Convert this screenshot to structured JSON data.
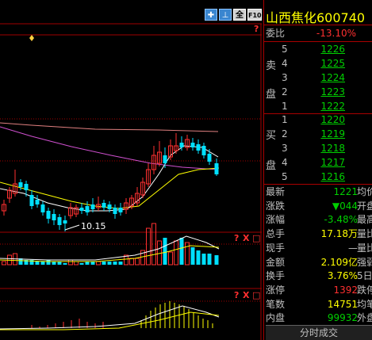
{
  "toolbar": {
    "btn_cross_glyph": "✚",
    "btn_flag_glyph": "⊥",
    "btn_full_label": "全",
    "btn_f10_label": "F10",
    "help_glyph": "?",
    "close_glyph": "X",
    "window_glyph": "□"
  },
  "stock": {
    "title": "山西焦化600740"
  },
  "chart": {
    "low_label": "10.15"
  },
  "quote": {
    "webi_label": "委比",
    "webi_value": "-13.10%",
    "sell_side": "卖盘",
    "buy_side": "买盘",
    "sell_levels": [
      {
        "level": "5",
        "price": "1226"
      },
      {
        "level": "4",
        "price": "1225"
      },
      {
        "level": "3",
        "price": "1224"
      },
      {
        "level": "2",
        "price": "1223"
      },
      {
        "level": "1",
        "price": "1222"
      }
    ],
    "buy_levels": [
      {
        "level": "1",
        "price": "1220"
      },
      {
        "level": "2",
        "price": "1219"
      },
      {
        "level": "3",
        "price": "1218"
      },
      {
        "level": "4",
        "price": "1217"
      },
      {
        "level": "5",
        "price": "1216"
      }
    ],
    "stats": [
      {
        "label": "最新",
        "value": "1221",
        "extra": "均价",
        "color": "#00d000"
      },
      {
        "label": "涨跌",
        "value": "▼044",
        "extra": "开盘",
        "color": "#00d000"
      },
      {
        "label": "涨幅",
        "value": "-3.48%",
        "extra": "最高",
        "color": "#00d000"
      },
      {
        "label": "总手",
        "value": "17.18万",
        "extra": "量比",
        "color": "#ffff00"
      },
      {
        "label": "现手",
        "value": "—",
        "extra": "量比",
        "color": "#c0c0c0"
      },
      {
        "label": "金额",
        "value": "2.109亿",
        "extra": "强弱",
        "color": "#ffff00"
      },
      {
        "label": "换手",
        "value": "3.76%",
        "extra": "5日",
        "color": "#ffff00"
      },
      {
        "label": "涨停",
        "value": "1392",
        "extra": "跌停",
        "color": "#ff3030"
      },
      {
        "label": "笔数",
        "value": "14751",
        "extra": "均笔",
        "color": "#ffff00"
      },
      {
        "label": "内盘",
        "value": "99932",
        "extra": "外盘",
        "color": "#00d000"
      }
    ],
    "bottom_tab": "分时成交"
  },
  "colors": {
    "up": "#ff3030",
    "down": "#00e0ff",
    "ma_white": "#ffffff",
    "ma_yellow": "#ffff00",
    "ma_purple": "#d050d0",
    "ma_pink": "#e08080",
    "grid": "#a00000"
  }
}
